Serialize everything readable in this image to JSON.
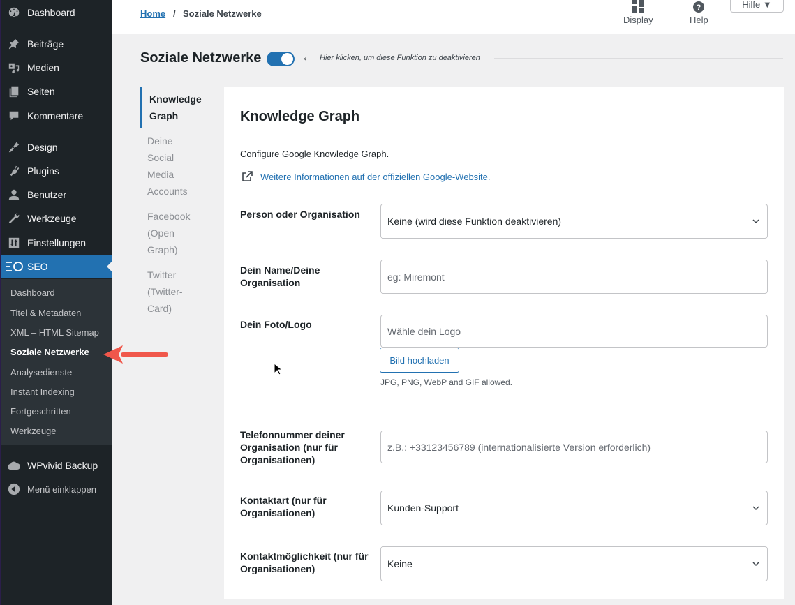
{
  "sidebar": {
    "items": [
      {
        "label": "Dashboard",
        "icon": "dashboard-icon"
      },
      {
        "label": "Beiträge",
        "icon": "pin-icon"
      },
      {
        "label": "Medien",
        "icon": "media-icon"
      },
      {
        "label": "Seiten",
        "icon": "pages-icon"
      },
      {
        "label": "Kommentare",
        "icon": "comment-icon"
      },
      {
        "label": "Design",
        "icon": "brush-icon"
      },
      {
        "label": "Plugins",
        "icon": "plugin-icon"
      },
      {
        "label": "Benutzer",
        "icon": "user-icon"
      },
      {
        "label": "Werkzeuge",
        "icon": "wrench-icon"
      },
      {
        "label": "Einstellungen",
        "icon": "settings-icon"
      },
      {
        "label": "SEO",
        "icon": "seo-icon",
        "current": true
      }
    ],
    "submenu": [
      {
        "label": "Dashboard"
      },
      {
        "label": "Titel & Metadaten"
      },
      {
        "label": "XML – HTML Sitemap"
      },
      {
        "label": "Soziale Netzwerke",
        "current": true
      },
      {
        "label": "Analysedienste"
      },
      {
        "label": "Instant Indexing"
      },
      {
        "label": "Fortgeschritten"
      },
      {
        "label": "Werkzeuge"
      }
    ],
    "bottom_items": [
      {
        "label": "WPvivid Backup",
        "icon": "cloud-icon"
      },
      {
        "label": "Menü einklappen",
        "icon": "collapse-icon"
      }
    ]
  },
  "header": {
    "breadcrumb": {
      "home": "Home",
      "separator": "/",
      "current": "Soziale Netzwerke"
    },
    "display_label": "Display",
    "help_label": "Help",
    "hilfe_label": "Hilfe ▼"
  },
  "page": {
    "title": "Soziale Netzwerke",
    "toggle_on": true,
    "toggle_hint": "Hier klicken, um diese Funktion zu deaktivieren",
    "accent_color": "#2271b1"
  },
  "subnav": [
    {
      "label": "Knowledge Graph",
      "active": true
    },
    {
      "label": "Deine Social Media Accounts"
    },
    {
      "label": "Facebook (Open Graph)"
    },
    {
      "label": "Twitter (Twitter-Card)"
    }
  ],
  "card": {
    "title": "Knowledge Graph",
    "description": "Configure Google Knowledge Graph.",
    "link_text": "Weitere Informationen auf der offiziellen Google-Website.",
    "fields": {
      "person_org": {
        "label": "Person oder Organisation",
        "value": "Keine (wird diese Funktion deaktivieren)"
      },
      "name": {
        "label": "Dein Name/Deine Organisation",
        "placeholder": "eg: Miremont"
      },
      "logo": {
        "label": "Dein Foto/Logo",
        "placeholder": "Wähle dein Logo",
        "upload_button": "Bild hochladen",
        "hint": "JPG, PNG, WebP and GIF allowed."
      },
      "phone": {
        "label": "Telefonnummer deiner Organisation (nur für Organisationen)",
        "placeholder": "z.B.: +33123456789 (internationalisierte Version erforderlich)"
      },
      "contact_type": {
        "label": "Kontaktart (nur für Organisationen)",
        "value": "Kunden-Support"
      },
      "contact_option": {
        "label": "Kontaktmöglichkeit (nur für Organisationen)",
        "value": "Keine"
      }
    }
  }
}
